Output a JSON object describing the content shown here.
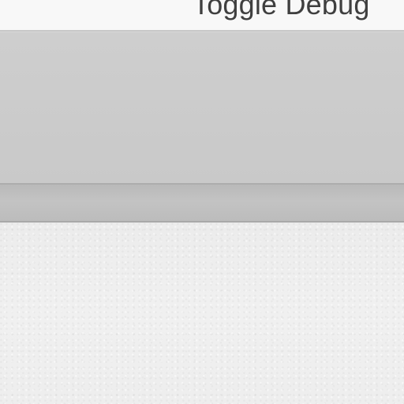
{
  "toolbar": {
    "toggle_debug_label": "Toggle Debug"
  },
  "colors": {
    "top_bar": "#f8f8f8",
    "panel": "#cccccc",
    "strip": "#bebebe",
    "textured_background": "#efefef",
    "label_text": "#3f3f3f"
  }
}
